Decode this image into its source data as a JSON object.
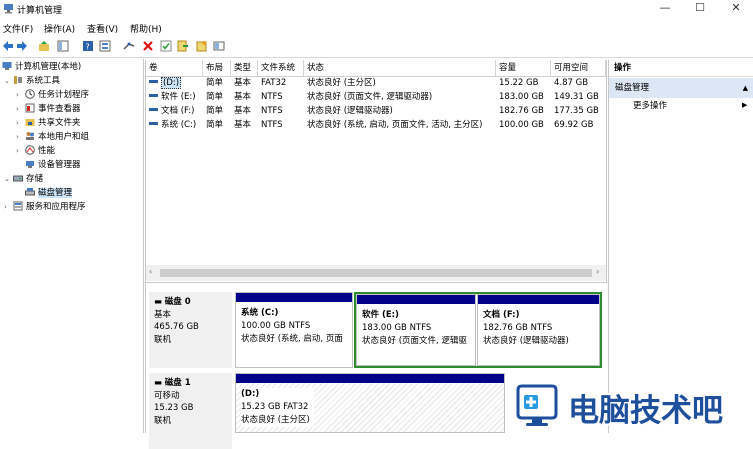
{
  "window": {
    "title": "计算机管理",
    "minimize_glyph": "—",
    "maximize_glyph": "☐",
    "close_glyph": "✕"
  },
  "menu": [
    "文件(F)",
    "操作(A)",
    "查看(V)",
    "帮助(H)"
  ],
  "toolbar_icons": [
    "back-arrow-icon",
    "forward-arrow-icon",
    "folder-up-icon",
    "console-tree-icon",
    "help-icon",
    "properties-icon",
    "connect-icon",
    "delete-icon",
    "check-icon",
    "export-icon",
    "wizard-icon",
    "view-icon"
  ],
  "tree": {
    "root": "计算机管理(本地)",
    "system_tools": "系统工具",
    "task_scheduler": "任务计划程序",
    "event_viewer": "事件查看器",
    "shared_folders": "共享文件夹",
    "local_users": "本地用户和组",
    "performance": "性能",
    "device_manager": "设备管理器",
    "storage": "存储",
    "disk_management": "磁盘管理",
    "services_apps": "服务和应用程序"
  },
  "volume_table": {
    "headers": [
      "卷",
      "布局",
      "类型",
      "文件系统",
      "状态",
      "容量",
      "可用空间"
    ],
    "rows": [
      [
        "(D:)",
        "简单",
        "基本",
        "FAT32",
        "状态良好 (主分区)",
        "15.22 GB",
        "4.87 GB"
      ],
      [
        "软件 (E:)",
        "简单",
        "基本",
        "NTFS",
        "状态良好 (页面文件, 逻辑驱动器)",
        "183.00 GB",
        "149.31 GB"
      ],
      [
        "文档 (F:)",
        "简单",
        "基本",
        "NTFS",
        "状态良好 (逻辑驱动器)",
        "182.76 GB",
        "177.35 GB"
      ],
      [
        "系统 (C:)",
        "简单",
        "基本",
        "NTFS",
        "状态良好 (系统, 启动, 页面文件, 活动, 主分区)",
        "100.00 GB",
        "69.92 GB"
      ]
    ],
    "scroll_left": "‹",
    "scroll_right": "›"
  },
  "disks": [
    {
      "name": "磁盘 0",
      "type": "基本",
      "size": "465.76 GB",
      "status": "联机",
      "partitions": [
        {
          "label": "系统 (C:)",
          "size": "100.00 GB NTFS",
          "status": "状态良好 (系统, 启动, 页面"
        },
        {
          "label": "软件 (E:)",
          "size": "183.00 GB NTFS",
          "status": "状态良好 (页面文件, 逻辑驱"
        },
        {
          "label": "文档 (F:)",
          "size": "182.76 GB NTFS",
          "status": "状态良好 (逻辑驱动器)"
        }
      ]
    },
    {
      "name": "磁盘 1",
      "type": "可移动",
      "size": "15.23 GB",
      "status": "联机",
      "partitions": [
        {
          "label": "(D:)",
          "size": "15.23 GB FAT32",
          "status": "状态良好 (主分区)"
        }
      ]
    }
  ],
  "actions": {
    "header": "操作",
    "section": "磁盘管理",
    "section_arrow": "▲",
    "more": "更多操作",
    "more_arrow": "▶"
  },
  "watermark": {
    "text": "电脑技术吧"
  },
  "colors": {
    "partition_bar": "#00008b",
    "extended_border": "#2e8b2e",
    "selection": "#cce4f7",
    "watermark": "#1e4f9c"
  }
}
